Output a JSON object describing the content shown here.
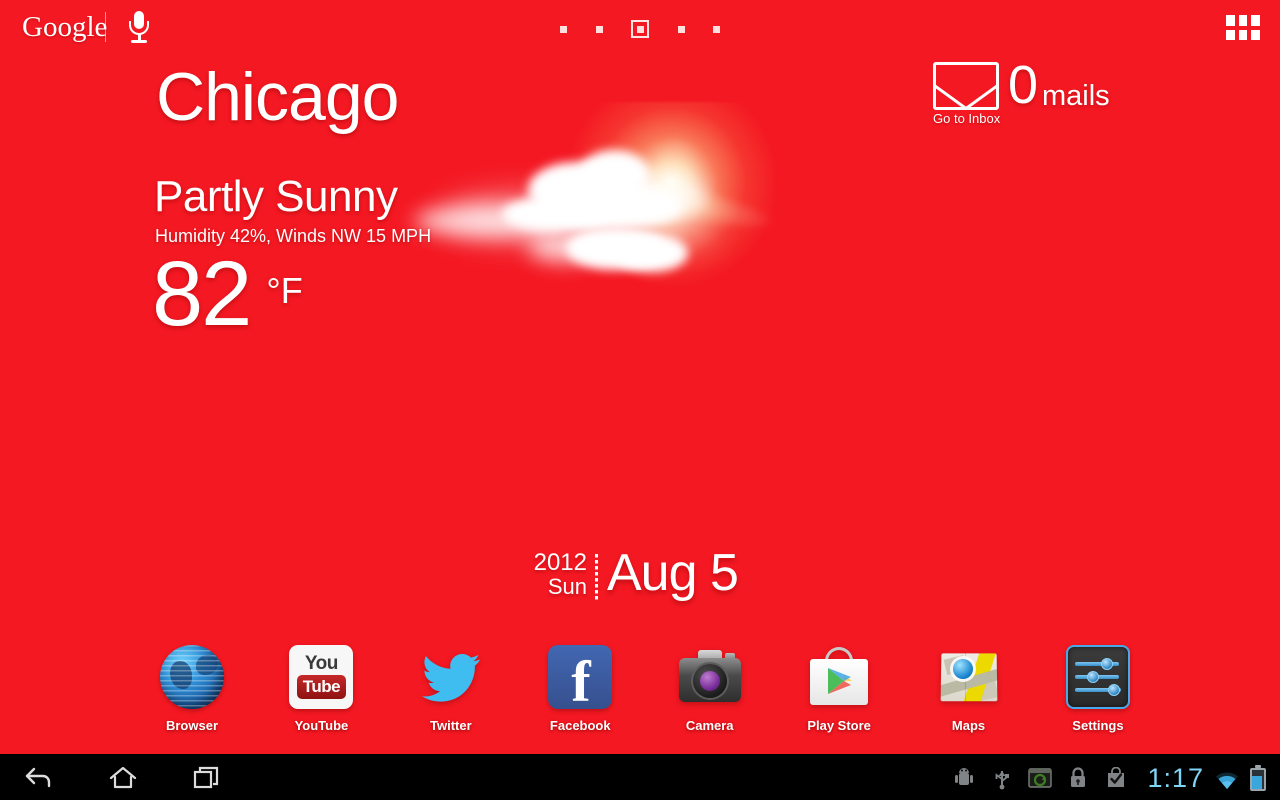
{
  "topbar": {
    "google_logo": "Google",
    "mic_icon": "microphone-icon",
    "apps_grid_icon": "apps-grid-icon",
    "page_indicator": {
      "total": 5,
      "active_index": 2
    }
  },
  "weather": {
    "city": "Chicago",
    "condition": "Partly Sunny",
    "details": "Humidity 42%, Winds NW 15 MPH",
    "temperature": "82",
    "unit": "°F",
    "icon": "sun-behind-cloud-icon"
  },
  "mail": {
    "icon": "envelope-icon",
    "count": "0",
    "label": "mails",
    "link": "Go to Inbox"
  },
  "date_widget": {
    "year": "2012",
    "weekday": "Sun",
    "date": "Aug 5"
  },
  "dock": {
    "apps": [
      {
        "label": "Browser",
        "icon": "browser-globe-icon"
      },
      {
        "label": "YouTube",
        "icon": "youtube-icon",
        "you": "You",
        "tube": "Tube"
      },
      {
        "label": "Twitter",
        "icon": "twitter-bird-icon"
      },
      {
        "label": "Facebook",
        "icon": "facebook-icon",
        "glyph": "f"
      },
      {
        "label": "Camera",
        "icon": "camera-icon"
      },
      {
        "label": "Play Store",
        "icon": "play-store-icon"
      },
      {
        "label": "Maps",
        "icon": "maps-icon"
      },
      {
        "label": "Settings",
        "icon": "settings-sliders-icon"
      }
    ]
  },
  "navbar": {
    "back_icon": "back-arrow-icon",
    "home_icon": "home-icon",
    "recents_icon": "recent-apps-icon",
    "status_icons": [
      "android-debug-icon",
      "usb-icon",
      "screenshot-sync-icon",
      "lock-icon",
      "check-bag-icon"
    ],
    "clock": "1:17",
    "wifi_icon": "wifi-icon",
    "battery_icon": "battery-icon"
  },
  "colors": {
    "background": "#f41822",
    "navbar": "#000000",
    "clock": "#7fd4f7",
    "text": "#ffffff"
  }
}
